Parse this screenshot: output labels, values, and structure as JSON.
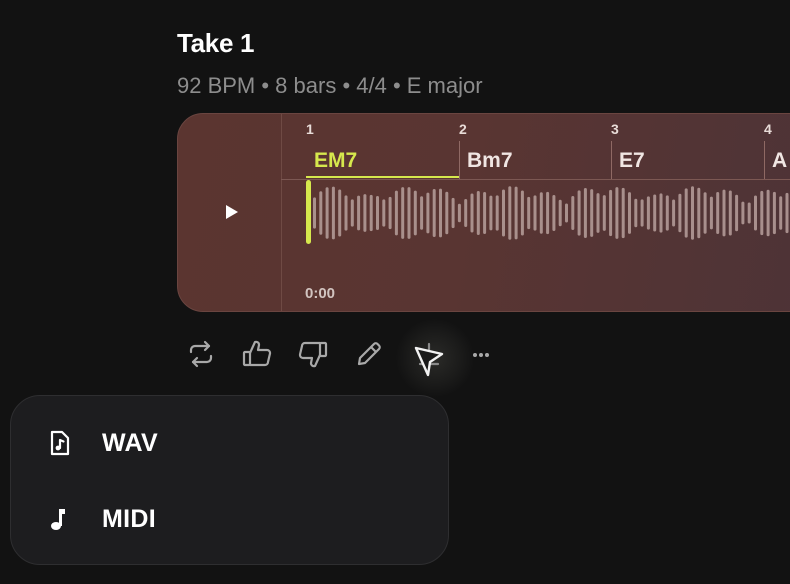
{
  "take": {
    "title": "Take 1",
    "subtitle": "92 BPM • 8 bars • 4/4 • E major"
  },
  "timeline": {
    "bars": [
      "1",
      "2",
      "3",
      "4"
    ],
    "chords": [
      "EM7",
      "Bm7",
      "E7",
      "A"
    ],
    "active_chord": "EM7",
    "time": "0:00",
    "playhead_position": 0,
    "colors": {
      "accent": "#d6e84d",
      "card": "#5a3531"
    }
  },
  "actions": {
    "items": [
      {
        "icon": "repeat-icon"
      },
      {
        "icon": "thumbs-up-icon"
      },
      {
        "icon": "thumbs-down-icon"
      },
      {
        "icon": "pencil-icon"
      },
      {
        "icon": "download-icon"
      },
      {
        "icon": "more-icon"
      }
    ]
  },
  "export_menu": {
    "items": [
      {
        "label": "WAV",
        "icon": "audio-file-icon"
      },
      {
        "label": "MIDI",
        "icon": "music-note-icon"
      }
    ]
  }
}
